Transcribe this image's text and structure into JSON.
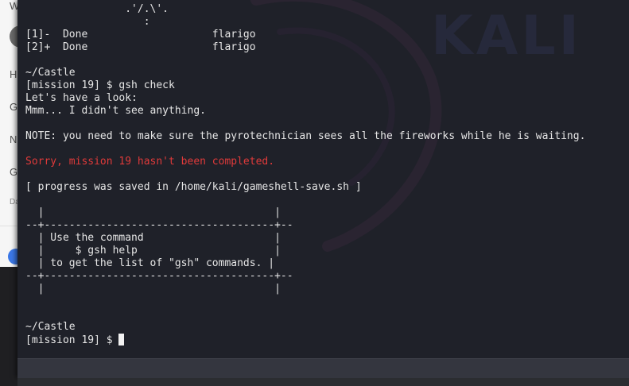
{
  "background_app": {
    "letters": [
      "W",
      "H",
      "G",
      "N",
      "G"
    ],
    "small_text": "Da"
  },
  "terminal": {
    "lines": [
      "                .'/.\\'.",
      "                   :",
      "[1]-  Done                    flarigo",
      "[2]+  Done                    flarigo",
      "",
      "~/Castle",
      "[mission 19] $ gsh check",
      "Let's have a look:",
      "Mmm... I didn't see anything.",
      "",
      "NOTE: you need to make sure the pyrotechnician sees all the fireworks while he is waiting.",
      "",
      "Sorry, mission 19 hasn't been completed.",
      "",
      "[ progress was saved in /home/kali/gameshell-save.sh ]",
      "",
      "  |                                     |",
      "--+-------------------------------------+--",
      "  | Use the command                     |",
      "  |     $ gsh help                      |",
      "  | to get the list of \"gsh\" commands. |",
      "--+-------------------------------------+--",
      "  |                                     |",
      "",
      "",
      "~/Castle",
      "[mission 19] $ "
    ],
    "error_line_index": 12,
    "colors": {
      "background": "#1f2129",
      "text": "#e6e6e6",
      "error": "#e03a3a"
    }
  },
  "wallpaper": {
    "logo_text": "KALI"
  }
}
